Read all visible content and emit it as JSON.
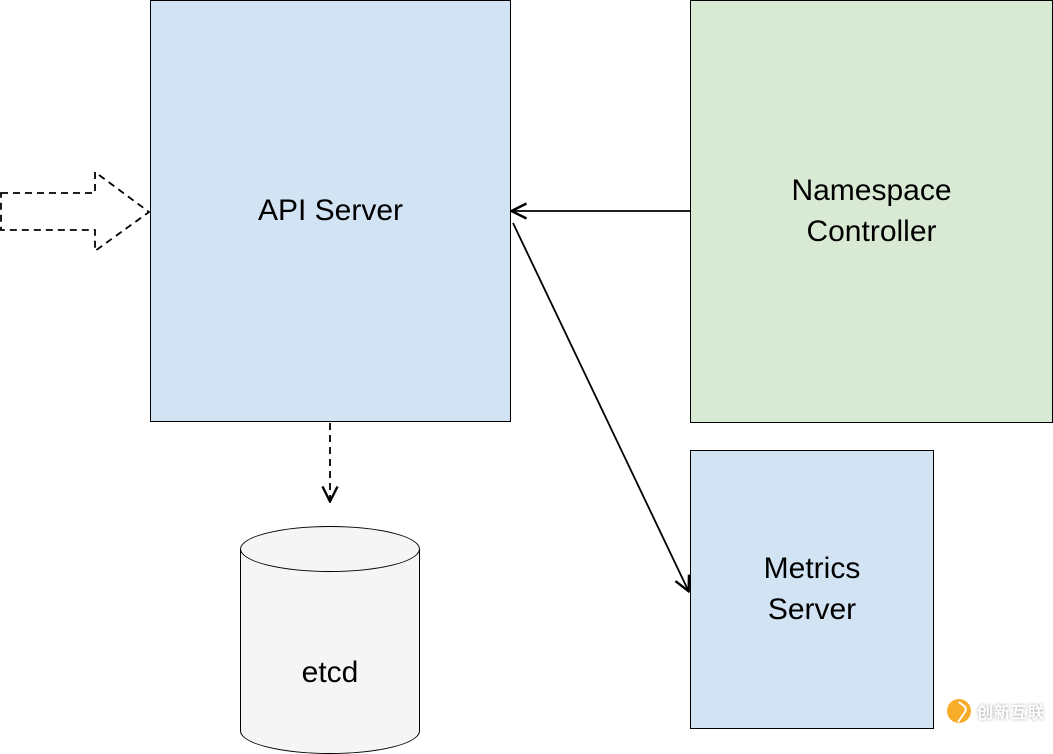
{
  "nodes": {
    "api_server": {
      "label": "API Server"
    },
    "namespace_controller": {
      "label": "Namespace\nController"
    },
    "metrics_server": {
      "label": "Metrics\nServer"
    },
    "etcd": {
      "label": "etcd"
    }
  },
  "edges": [
    {
      "from": "external-input",
      "to": "api_server",
      "style": "dashed",
      "arrow_shape": "block"
    },
    {
      "from": "namespace_controller",
      "to": "api_server",
      "style": "solid",
      "arrow_shape": "open"
    },
    {
      "from": "api_server",
      "to": "metrics_server",
      "style": "solid",
      "arrow_shape": "open",
      "note": "arrowhead near metrics_server end"
    },
    {
      "from": "api_server",
      "to": "etcd",
      "style": "dashed",
      "arrow_shape": "open"
    }
  ],
  "watermark": {
    "text": "创新互联"
  },
  "colors": {
    "api_server_fill": "#d2e3f3",
    "namespace_controller_fill": "#d8ead3",
    "metrics_server_fill": "#d2e3f3",
    "etcd_fill": "#f5f5f5",
    "stroke": "#000000"
  }
}
